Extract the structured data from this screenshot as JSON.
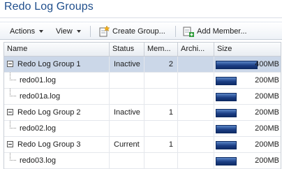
{
  "page": {
    "title": "Redo Log Groups"
  },
  "toolbar": {
    "actions_label": "Actions",
    "view_label": "View",
    "create_group_label": "Create Group...",
    "add_member_label": "Add Member..."
  },
  "table": {
    "columns": {
      "name": "Name",
      "status": "Status",
      "members": "Mem...",
      "archived": "Archi...",
      "size": "Size"
    },
    "max_size_mb": 400,
    "rows": [
      {
        "type": "group",
        "name": "Redo Log Group 1",
        "status": "Inactive",
        "members": "2",
        "archived": "",
        "size_label": "400MB",
        "size_mb": 400,
        "selected": true
      },
      {
        "type": "member",
        "name": "redo01.log",
        "status": "",
        "members": "",
        "archived": "",
        "size_label": "200MB",
        "size_mb": 200
      },
      {
        "type": "member",
        "name": "redo01a.log",
        "status": "",
        "members": "",
        "archived": "",
        "size_label": "200MB",
        "size_mb": 200
      },
      {
        "type": "group",
        "name": "Redo Log Group 2",
        "status": "Inactive",
        "members": "1",
        "archived": "",
        "size_label": "200MB",
        "size_mb": 200,
        "selected": false
      },
      {
        "type": "member",
        "name": "redo02.log",
        "status": "",
        "members": "",
        "archived": "",
        "size_label": "200MB",
        "size_mb": 200
      },
      {
        "type": "group",
        "name": "Redo Log Group 3",
        "status": "Current",
        "members": "1",
        "archived": "",
        "size_label": "200MB",
        "size_mb": 200,
        "selected": false
      },
      {
        "type": "member",
        "name": "redo03.log",
        "status": "",
        "members": "",
        "archived": "",
        "size_label": "200MB",
        "size_mb": 200
      }
    ]
  },
  "icons": {
    "create_group": "create-group-icon",
    "add_member": "add-member-icon",
    "expander": "collapse-icon"
  },
  "colors": {
    "title": "#1f4e8c",
    "selected_row": "#cbd7e8",
    "bar": "#1c3f86"
  }
}
